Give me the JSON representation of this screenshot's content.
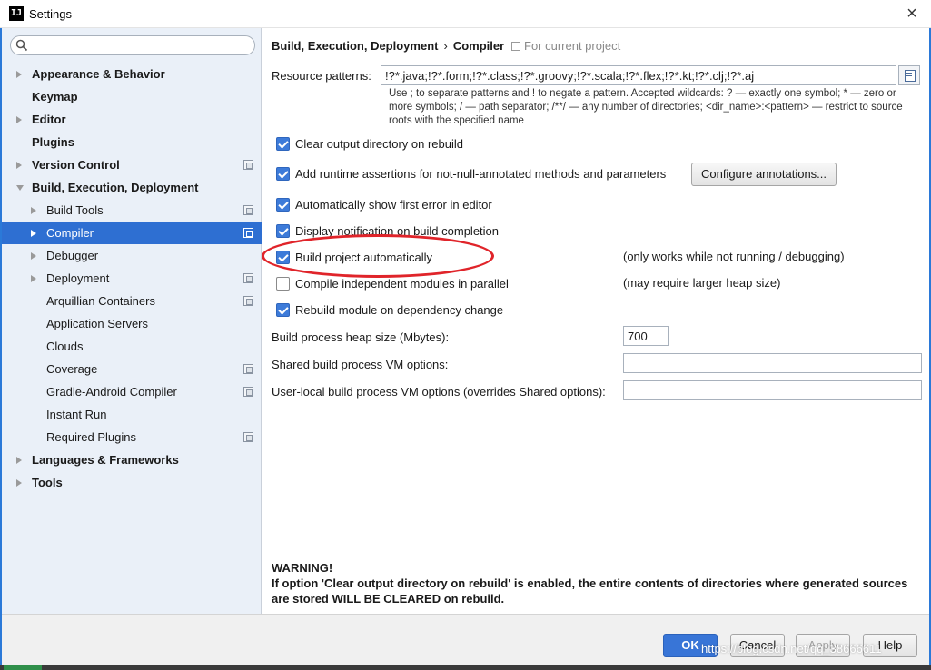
{
  "window": {
    "title": "Settings",
    "app_icon": "IJ",
    "close_glyph": "×"
  },
  "search": {
    "placeholder": "",
    "value": ""
  },
  "tree": [
    {
      "label": "Appearance & Behavior",
      "level": 0,
      "bold": true,
      "arrow": "right",
      "proj": false,
      "selected": false,
      "name": "tree-item-appearance-behavior"
    },
    {
      "label": "Keymap",
      "level": 0,
      "bold": true,
      "arrow": "none",
      "proj": false,
      "selected": false,
      "name": "tree-item-keymap"
    },
    {
      "label": "Editor",
      "level": 0,
      "bold": true,
      "arrow": "right",
      "proj": false,
      "selected": false,
      "name": "tree-item-editor"
    },
    {
      "label": "Plugins",
      "level": 0,
      "bold": true,
      "arrow": "none",
      "proj": false,
      "selected": false,
      "name": "tree-item-plugins"
    },
    {
      "label": "Version Control",
      "level": 0,
      "bold": true,
      "arrow": "right",
      "proj": true,
      "selected": false,
      "name": "tree-item-version-control"
    },
    {
      "label": "Build, Execution, Deployment",
      "level": 0,
      "bold": true,
      "arrow": "down",
      "proj": false,
      "selected": false,
      "name": "tree-item-build-execution-deployment"
    },
    {
      "label": "Build Tools",
      "level": 1,
      "bold": false,
      "arrow": "right",
      "proj": true,
      "selected": false,
      "name": "tree-item-build-tools"
    },
    {
      "label": "Compiler",
      "level": 1,
      "bold": false,
      "arrow": "right",
      "proj": true,
      "selected": true,
      "name": "tree-item-compiler"
    },
    {
      "label": "Debugger",
      "level": 1,
      "bold": false,
      "arrow": "right",
      "proj": false,
      "selected": false,
      "name": "tree-item-debugger"
    },
    {
      "label": "Deployment",
      "level": 1,
      "bold": false,
      "arrow": "right",
      "proj": true,
      "selected": false,
      "name": "tree-item-deployment"
    },
    {
      "label": "Arquillian Containers",
      "level": 1,
      "bold": false,
      "arrow": "none",
      "proj": true,
      "selected": false,
      "name": "tree-item-arquillian-containers"
    },
    {
      "label": "Application Servers",
      "level": 1,
      "bold": false,
      "arrow": "none",
      "proj": false,
      "selected": false,
      "name": "tree-item-application-servers"
    },
    {
      "label": "Clouds",
      "level": 1,
      "bold": false,
      "arrow": "none",
      "proj": false,
      "selected": false,
      "name": "tree-item-clouds"
    },
    {
      "label": "Coverage",
      "level": 1,
      "bold": false,
      "arrow": "none",
      "proj": true,
      "selected": false,
      "name": "tree-item-coverage"
    },
    {
      "label": "Gradle-Android Compiler",
      "level": 1,
      "bold": false,
      "arrow": "none",
      "proj": true,
      "selected": false,
      "name": "tree-item-gradle-android-compiler"
    },
    {
      "label": "Instant Run",
      "level": 1,
      "bold": false,
      "arrow": "none",
      "proj": false,
      "selected": false,
      "name": "tree-item-instant-run"
    },
    {
      "label": "Required Plugins",
      "level": 1,
      "bold": false,
      "arrow": "none",
      "proj": true,
      "selected": false,
      "name": "tree-item-required-plugins"
    },
    {
      "label": "Languages & Frameworks",
      "level": 0,
      "bold": true,
      "arrow": "right",
      "proj": false,
      "selected": false,
      "name": "tree-item-languages-frameworks"
    },
    {
      "label": "Tools",
      "level": 0,
      "bold": true,
      "arrow": "right",
      "proj": false,
      "selected": false,
      "name": "tree-item-tools"
    }
  ],
  "header": {
    "crumb_parent": "Build, Execution, Deployment",
    "crumb_sep": "›",
    "crumb_current": "Compiler",
    "scope": "For current project"
  },
  "resource_patterns": {
    "label": "Resource patterns:",
    "value": "!?*.java;!?*.form;!?*.class;!?*.groovy;!?*.scala;!?*.flex;!?*.kt;!?*.clj;!?*.aj",
    "help": "Use ; to separate patterns and ! to negate a pattern. Accepted wildcards: ? — exactly one symbol; * — zero or more symbols; / — path separator; /**/ — any number of directories; <dir_name>:<pattern> — restrict to source roots with the specified name"
  },
  "options": {
    "clear_output": {
      "label": "Clear output directory on rebuild",
      "checked": true
    },
    "runtime_assertions": {
      "label": "Add runtime assertions for not-null-annotated methods and parameters",
      "checked": true
    },
    "show_first_error": {
      "label": "Automatically show first error in editor",
      "checked": true
    },
    "display_notification": {
      "label": "Display notification on build completion",
      "checked": true
    },
    "build_automatically": {
      "label": "Build project automatically",
      "checked": true,
      "note": "(only works while not running / debugging)"
    },
    "compile_parallel": {
      "label": "Compile independent modules in parallel",
      "checked": false,
      "note": "(may require larger heap size)"
    },
    "rebuild_module": {
      "label": "Rebuild module on dependency change",
      "checked": true
    }
  },
  "configure_annotations_label": "Configure annotations...",
  "heap_size": {
    "label": "Build process heap size (Mbytes):",
    "value": "700"
  },
  "shared_vm": {
    "label": "Shared build process VM options:",
    "value": ""
  },
  "user_vm": {
    "label": "User-local build process VM options (overrides Shared options):",
    "value": ""
  },
  "warning": {
    "title": "WARNING!",
    "body": "If option 'Clear output directory on rebuild' is enabled, the entire contents of directories where generated sources are stored WILL BE CLEARED on rebuild."
  },
  "buttons": {
    "ok": "OK",
    "cancel": "Cancel",
    "apply": "Apply",
    "help": "Help"
  },
  "watermark": "https://blog.csdn.net/qq_38666611",
  "colors": {
    "accent": "#2e6fd2",
    "checkbox": "#3d7bd9",
    "highlight_ellipse": "#e0242a",
    "sidebar_bg": "#eaf0f8"
  }
}
